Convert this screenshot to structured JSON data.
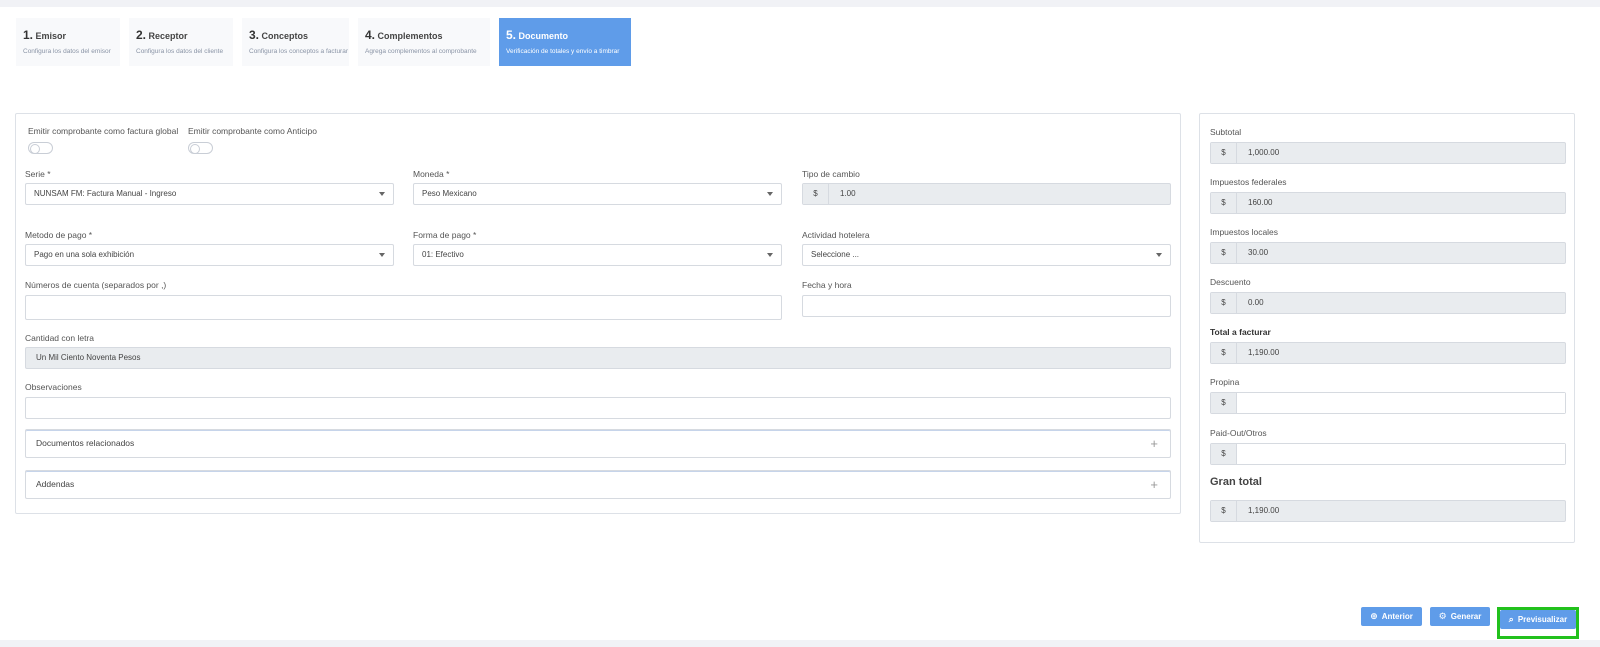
{
  "steps": [
    {
      "num": "1.",
      "name": "Emisor",
      "sub": "Configura los datos del emisor"
    },
    {
      "num": "2.",
      "name": "Receptor",
      "sub": "Configura los datos del cliente"
    },
    {
      "num": "3.",
      "name": "Conceptos",
      "sub": "Configura los conceptos a facturar"
    },
    {
      "num": "4.",
      "name": "Complementos",
      "sub": "Agrega complementos al comprobante"
    },
    {
      "num": "5.",
      "name": "Documento",
      "sub": "Verificación de totales y envío a timbrar"
    }
  ],
  "form": {
    "toggle_global_label": "Emitir comprobante como factura global",
    "toggle_anticipo_label": "Emitir comprobante como Anticipo",
    "serie_label": "Serie *",
    "serie_value": "NUNSAM FM: Factura Manual - Ingreso",
    "moneda_label": "Moneda *",
    "moneda_value": "Peso Mexicano",
    "tipo_cambio_label": "Tipo de cambio",
    "tipo_cambio_symbol": "$",
    "tipo_cambio_value": "1.00",
    "metodo_label": "Metodo de pago *",
    "metodo_value": "Pago en una sola exhibición",
    "forma_label": "Forma de pago *",
    "forma_value": "01: Efectivo",
    "actividad_label": "Actividad hotelera",
    "actividad_value": "Seleccione ...",
    "cuentas_label": "Números de cuenta (separados por ,)",
    "cuentas_value": "",
    "fecha_label": "Fecha y hora",
    "fecha_value": "",
    "cantidad_label": "Cantidad con letra",
    "cantidad_value": "Un Mil Ciento Noventa Pesos",
    "observaciones_label": "Observaciones",
    "observaciones_value": "",
    "docs_label": "Documentos relacionados",
    "addendas_label": "Addendas",
    "plus": "+"
  },
  "totals": {
    "currency": "$",
    "subtotal_label": "Subtotal",
    "subtotal_value": "1,000.00",
    "federales_label": "Impuestos federales",
    "federales_value": "160.00",
    "locales_label": "Impuestos locales",
    "locales_value": "30.00",
    "descuento_label": "Descuento",
    "descuento_value": "0.00",
    "total_label": "Total a facturar",
    "total_value": "1,190.00",
    "propina_label": "Propina",
    "propina_value": "",
    "paidout_label": "Paid-Out/Otros",
    "paidout_value": "",
    "gran_total_label": "Gran total",
    "gran_total_value": "1,190.00"
  },
  "buttons": {
    "anterior": "Anterior",
    "generar": "Generar",
    "previsualizar": "Previsualizar"
  },
  "colors": {
    "accent": "#5f9ce9",
    "highlight": "#22c11c"
  }
}
